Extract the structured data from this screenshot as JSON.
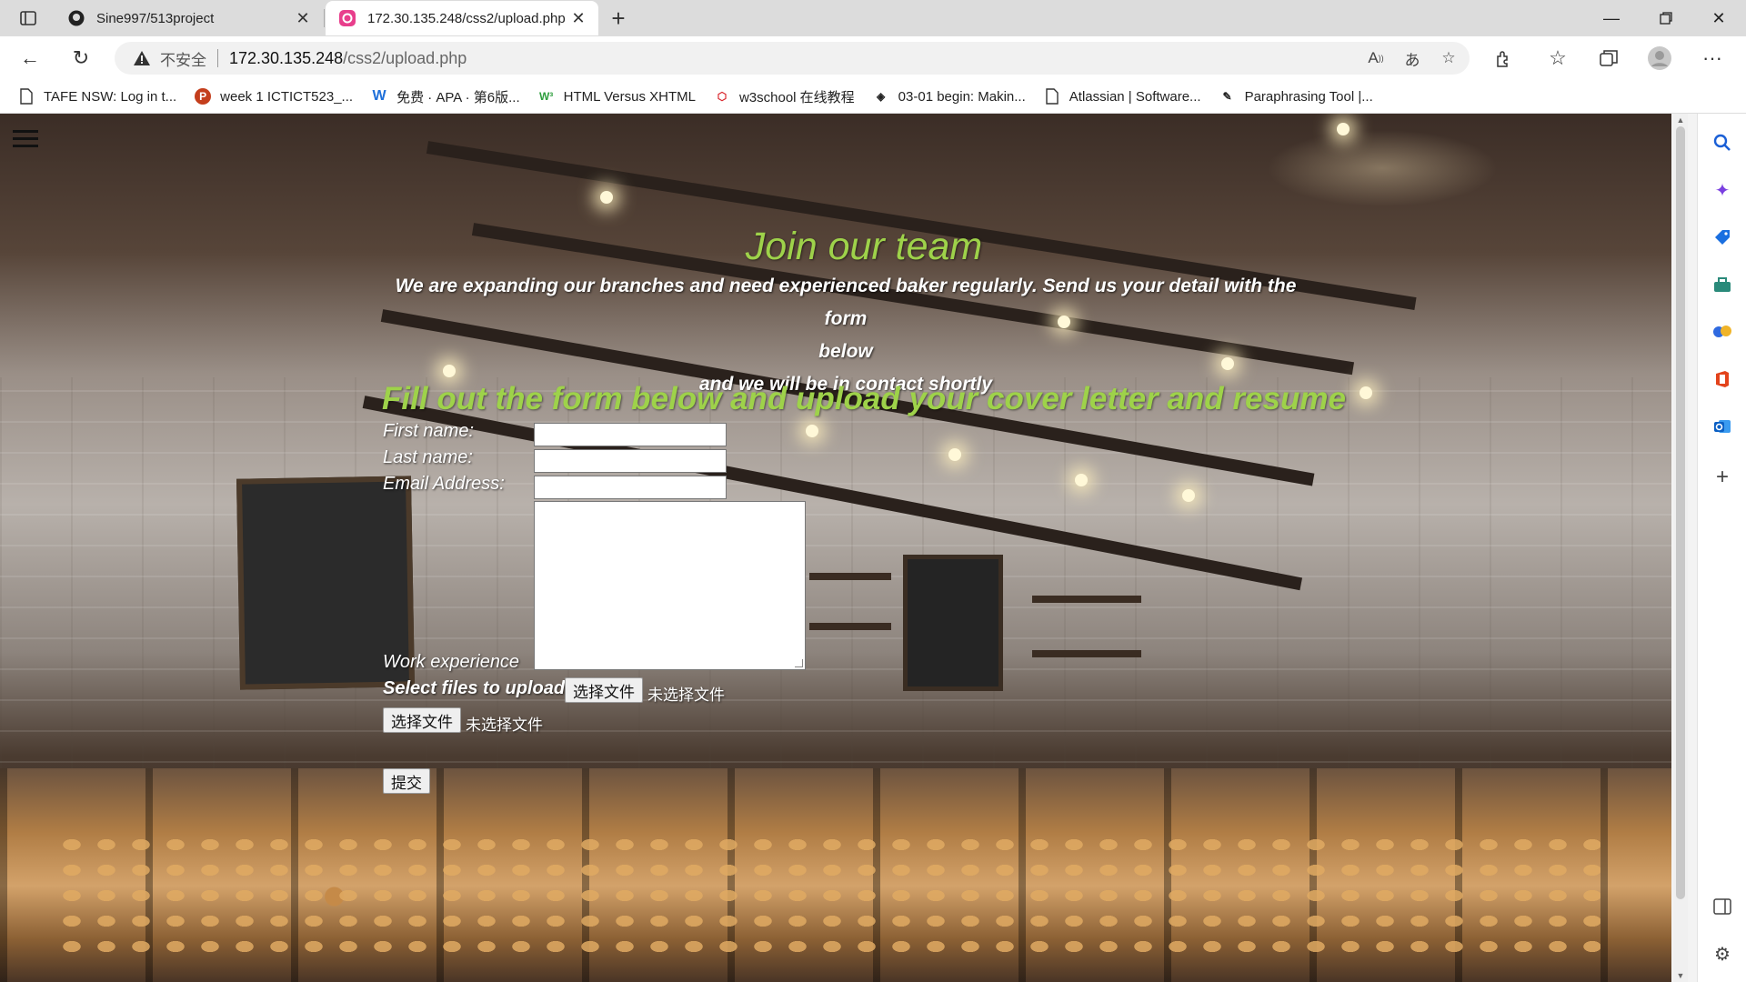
{
  "browser": {
    "tabs": [
      {
        "title": "Sine997/513project",
        "active": false,
        "icon": "github-icon"
      },
      {
        "title": "172.30.135.248/css2/upload.php",
        "active": true,
        "icon": "site-icon"
      }
    ],
    "address": {
      "security_label": "不安全",
      "host": "172.30.135.248",
      "path": "/css2/upload.php"
    },
    "bookmarks": [
      {
        "label": "TAFE NSW: Log in t...",
        "icon": "page-icon"
      },
      {
        "label": "week 1 ICTICT523_...",
        "icon": "powerpoint-icon"
      },
      {
        "label": "免费 · APA · 第6版...",
        "icon": "w-logo-icon"
      },
      {
        "label": "HTML Versus XHTML",
        "icon": "w3-logo-icon"
      },
      {
        "label": "w3school 在线教程",
        "icon": "w3school-icon"
      },
      {
        "label": "03-01 begin: Makin...",
        "icon": "codepen-icon"
      },
      {
        "label": "Atlassian | Software...",
        "icon": "page-icon"
      },
      {
        "label": "Paraphrasing Tool |...",
        "icon": "quill-icon"
      }
    ],
    "colors": {
      "accent": "#9ed24a",
      "chrome": "#dcdcdc"
    }
  },
  "page": {
    "join_title": "Join our team",
    "intro_line1": "We are expanding our branches and need experienced baker regularly. Send us your detail with the form",
    "intro_line2": "below",
    "intro_line3": "and we will be in contact shortly",
    "form_title": "Fill out the form below and upload your cover letter and resume",
    "form": {
      "first_name_label": "First name:",
      "first_name_value": "",
      "last_name_label": "Last name:",
      "last_name_value": "",
      "email_label": "Email Address:",
      "email_value": "",
      "experience_label": "Work experience",
      "experience_value": "",
      "upload_label": "Select files to upload:",
      "choose_file_label": "选择文件",
      "no_file_label": "未选择文件",
      "choose_file_label_2": "选择文件",
      "no_file_label_2": "未选择文件",
      "submit_label": "提交"
    }
  }
}
